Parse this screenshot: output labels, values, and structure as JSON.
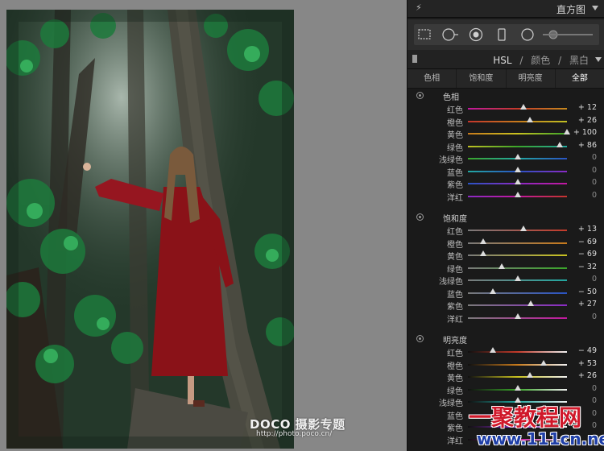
{
  "histogram_panel": {
    "title": "直方图"
  },
  "tool_strip": {
    "tools": [
      "crop-overlay-icon",
      "spot-removal-icon",
      "red-eye-icon",
      "graduated-filter-icon",
      "radial-filter-icon",
      "adjustment-brush-icon"
    ]
  },
  "hsl_panel": {
    "tabs": [
      "HSL",
      "颜色",
      "黑白"
    ],
    "active_tab": "HSL",
    "separator": "/",
    "sub_tabs": [
      "色相",
      "饱和度",
      "明亮度",
      "全部"
    ],
    "active_sub_tab": "全部"
  },
  "sections": [
    {
      "title": "色相",
      "rows": [
        {
          "label": "红色",
          "value": "+ 12",
          "level": 12
        },
        {
          "label": "橙色",
          "value": "+ 26",
          "level": 26
        },
        {
          "label": "黄色",
          "value": "+ 100",
          "level": 100
        },
        {
          "label": "绿色",
          "value": "+ 86",
          "level": 86
        },
        {
          "label": "浅绿色",
          "value": "0",
          "level": 0
        },
        {
          "label": "蓝色",
          "value": "0",
          "level": 0
        },
        {
          "label": "紫色",
          "value": "0",
          "level": 0
        },
        {
          "label": "洋红",
          "value": "0",
          "level": 0
        }
      ]
    },
    {
      "title": "饱和度",
      "rows": [
        {
          "label": "红色",
          "value": "+ 13",
          "level": 13
        },
        {
          "label": "橙色",
          "value": "− 69",
          "level": -69
        },
        {
          "label": "黄色",
          "value": "− 69",
          "level": -69
        },
        {
          "label": "绿色",
          "value": "− 32",
          "level": -32
        },
        {
          "label": "浅绿色",
          "value": "0",
          "level": 0
        },
        {
          "label": "蓝色",
          "value": "− 50",
          "level": -50
        },
        {
          "label": "紫色",
          "value": "+ 27",
          "level": 27
        },
        {
          "label": "洋红",
          "value": "0",
          "level": 0
        }
      ]
    },
    {
      "title": "明亮度",
      "rows": [
        {
          "label": "红色",
          "value": "− 49",
          "level": -49
        },
        {
          "label": "橙色",
          "value": "+ 53",
          "level": 53
        },
        {
          "label": "黄色",
          "value": "+ 26",
          "level": 26
        },
        {
          "label": "绿色",
          "value": "0",
          "level": 0
        },
        {
          "label": "浅绿色",
          "value": "0",
          "level": 0
        },
        {
          "label": "蓝色",
          "value": "0",
          "level": 0
        },
        {
          "label": "紫色",
          "value": "0",
          "level": 0
        },
        {
          "label": "洋红",
          "value": "0",
          "level": 0
        }
      ]
    }
  ],
  "track_colors": {
    "红色": [
      "#c2189f",
      "#c43a2a",
      "#c78a1e"
    ],
    "橙色": [
      "#c4352c",
      "#c77a1c",
      "#bfbf22"
    ],
    "黄色": [
      "#c77a1c",
      "#c9c220",
      "#3aa52a"
    ],
    "绿色": [
      "#bfbf22",
      "#3aa52a",
      "#22a7a0"
    ],
    "浅绿色": [
      "#3aa52a",
      "#22a7a0",
      "#2a54c4"
    ],
    "蓝色": [
      "#22a7a0",
      "#2a54c4",
      "#8a2ac4"
    ],
    "紫色": [
      "#2a54c4",
      "#8a2ac4",
      "#c2189f"
    ],
    "洋红": [
      "#8a2ac4",
      "#c2189f",
      "#c4352c"
    ],
    "saturation_start": "#7a7a7a",
    "luminance_start": "#101010",
    "luminance_end": "#f0f0f0"
  },
  "photo": {
    "watermark": "DOCO 摄影专题",
    "watermark_url": "http://photo.poco.cn/"
  },
  "corner_watermark": {
    "brand": "一聚教程网",
    "url": "www.111cn.net"
  }
}
